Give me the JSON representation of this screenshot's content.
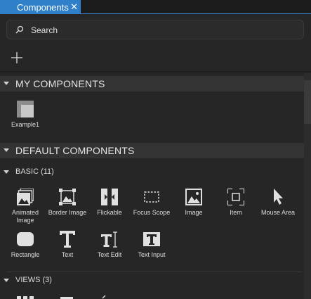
{
  "tab": {
    "title": "Components",
    "close": "✕"
  },
  "search": {
    "placeholder": "Search"
  },
  "sections": {
    "my": "MY COMPONENTS",
    "default": "DEFAULT COMPONENTS"
  },
  "my_components": [
    {
      "label": "Example1",
      "icon": "component-icon"
    }
  ],
  "basic": {
    "header": "BASIC (11)",
    "items": [
      {
        "label": "Animated\nImage",
        "icon": "animated-image-icon"
      },
      {
        "label": "Border Image",
        "icon": "border-image-icon"
      },
      {
        "label": "Flickable",
        "icon": "flickable-icon"
      },
      {
        "label": "Focus Scope",
        "icon": "focus-scope-icon"
      },
      {
        "label": "Image",
        "icon": "image-icon"
      },
      {
        "label": "Item",
        "icon": "item-icon"
      },
      {
        "label": "Mouse Area",
        "icon": "mouse-area-icon"
      },
      {
        "label": "Rectangle",
        "icon": "rectangle-icon"
      },
      {
        "label": "Text",
        "icon": "text-icon"
      },
      {
        "label": "Text Edit",
        "icon": "text-edit-icon"
      },
      {
        "label": "Text Input",
        "icon": "text-input-icon"
      }
    ]
  },
  "views": {
    "header": "VIEWS (3)"
  }
}
